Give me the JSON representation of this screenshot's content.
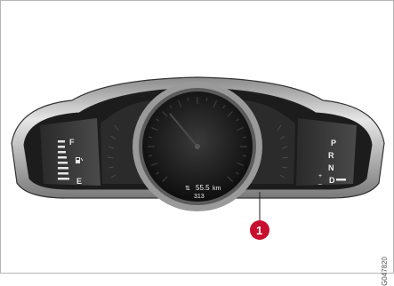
{
  "fuel_gauge": {
    "full_label": "F",
    "empty_label": "E"
  },
  "gear_indicator": {
    "gears": [
      "P",
      "R",
      "N",
      "D"
    ],
    "plus_minus": "+\n–"
  },
  "trip_display": {
    "distance": "55.5",
    "unit": "km",
    "odometer": "313"
  },
  "callout": {
    "number": "1"
  },
  "figure_code": "G047820",
  "colors": {
    "bezel_light": "#d9d9d9",
    "bezel_dark": "#6f6f6f",
    "display_dark": "#1e1e1e",
    "callout_red": "#c8102e"
  }
}
